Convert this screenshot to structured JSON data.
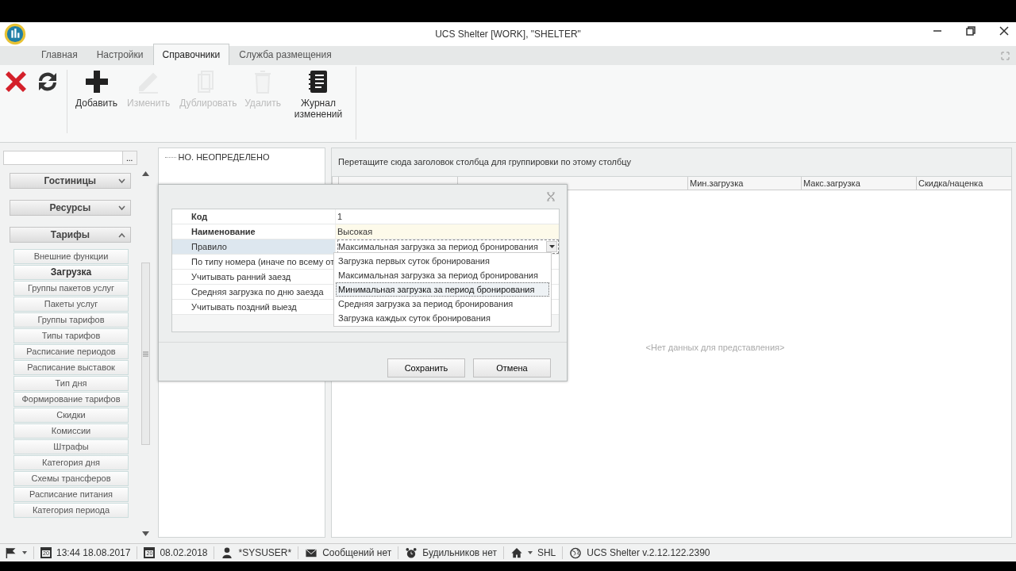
{
  "window": {
    "title": "UCS Shelter [WORK], \"SHELTER\""
  },
  "tabs": [
    {
      "label": "Главная",
      "selected": false
    },
    {
      "label": "Настройки",
      "selected": false
    },
    {
      "label": "Справочники",
      "selected": true
    },
    {
      "label": "Служба размещения",
      "selected": false
    }
  ],
  "toolbar": [
    {
      "kind": "close",
      "disabled": false
    },
    {
      "kind": "refresh",
      "disabled": false
    },
    {
      "kind": "add",
      "label": "Добавить",
      "disabled": false
    },
    {
      "kind": "edit",
      "label": "Изменить",
      "disabled": true
    },
    {
      "kind": "copy",
      "label": "Дублировать",
      "disabled": true
    },
    {
      "kind": "delete",
      "label": "Удалить",
      "disabled": true
    },
    {
      "kind": "journal",
      "label": "Журнал изменений",
      "disabled": false
    }
  ],
  "sidebar": {
    "browse_label": "...",
    "groups": [
      {
        "label": "Гостиницы",
        "expanded": false
      },
      {
        "label": "Ресурсы",
        "expanded": false
      },
      {
        "label": "Тарифы",
        "expanded": true,
        "items": [
          {
            "label": "Внешние функции",
            "selected": false
          },
          {
            "label": "Загрузка",
            "selected": true
          },
          {
            "label": "Группы пакетов услуг",
            "selected": false
          },
          {
            "label": "Пакеты услуг",
            "selected": false
          },
          {
            "label": "Группы тарифов",
            "selected": false
          },
          {
            "label": "Типы тарифов",
            "selected": false
          },
          {
            "label": "Расписание периодов",
            "selected": false
          },
          {
            "label": "Расписание выставок",
            "selected": false
          },
          {
            "label": "Тип дня",
            "selected": false
          },
          {
            "label": "Формирование тарифов",
            "selected": false
          },
          {
            "label": "Скидки",
            "selected": false
          },
          {
            "label": "Комиссии",
            "selected": false
          },
          {
            "label": "Штрафы",
            "selected": false
          },
          {
            "label": "Категория дня",
            "selected": false
          },
          {
            "label": "Схемы трансферов",
            "selected": false
          },
          {
            "label": "Расписание питания",
            "selected": false
          },
          {
            "label": "Категория периода",
            "selected": false
          }
        ]
      }
    ]
  },
  "tree": [
    {
      "label": "НО. НЕОПРЕДЕЛЕНО"
    }
  ],
  "grid": {
    "group_hint": "Перетащите сюда заголовок столбца для группировки по этому столбцу",
    "columns": [
      "Мин.загрузка",
      "Макс.загрузка",
      "Скидка/наценка"
    ],
    "empty_text": "<Нет данных для представления>"
  },
  "dialog": {
    "fields": [
      {
        "label": "Код",
        "value": "1",
        "required": true,
        "selected": false
      },
      {
        "label": "Наименование",
        "value": "Высокая",
        "required": true,
        "selected": false
      },
      {
        "label": "Правило",
        "value": "Максимальная загрузка за период бронирования",
        "required": false,
        "selected": true
      },
      {
        "label": "По типу номера (иначе по всему от",
        "required": false,
        "selected": false
      },
      {
        "label": "Учитывать ранний заезд",
        "required": false,
        "selected": false
      },
      {
        "label": "Средняя загрузка по дню заезда",
        "required": false,
        "selected": false
      },
      {
        "label": "Учитывать поздний выезд",
        "required": false,
        "selected": false
      }
    ],
    "options": [
      {
        "label": "Загрузка первых суток бронирования",
        "hovered": false
      },
      {
        "label": "Максимальная загрузка за период бронирования",
        "hovered": false
      },
      {
        "label": "Минимальная загрузка за период бронирования",
        "hovered": true
      },
      {
        "label": "Средняя загрузка за период бронирования",
        "hovered": false
      },
      {
        "label": "Загрузка каждых суток бронирования",
        "hovered": false
      }
    ],
    "buttons": [
      "Сохранить",
      "Отмена"
    ]
  },
  "status_bar": [
    {
      "kind": "flag"
    },
    {
      "kind": "calendar",
      "badge": "20",
      "text": "13:44 18.08.2017"
    },
    {
      "kind": "calendar",
      "badge": "20",
      "text": "08.02.2018"
    },
    {
      "kind": "user",
      "text": "*SYSUSER*"
    },
    {
      "kind": "mail",
      "text": "Сообщений нет"
    },
    {
      "kind": "alarm",
      "text": "Будильников нет"
    },
    {
      "kind": "home",
      "text": "SHL"
    },
    {
      "kind": "globe",
      "text": "UCS Shelter v.2.12.122.2390"
    }
  ]
}
